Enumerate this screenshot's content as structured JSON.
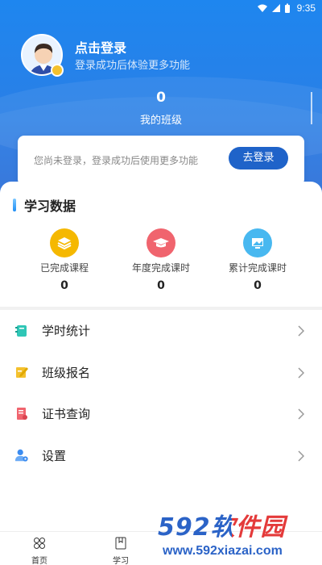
{
  "status_bar": {
    "time": "9:35"
  },
  "header": {
    "login_title": "点击登录",
    "login_subtitle": "登录成功后体验更多功能",
    "class_count": "0",
    "class_label": "我的班级"
  },
  "notice": {
    "text": "您尚未登录，登录成功后使用更多功能",
    "button": "去登录"
  },
  "learning_data": {
    "title": "学习数据",
    "stats": [
      {
        "label": "已完成课程",
        "value": "0",
        "icon": "layers-icon",
        "color": "#f5b800"
      },
      {
        "label": "年度完成课时",
        "value": "0",
        "icon": "graduation-cap-icon",
        "color": "#f0646e"
      },
      {
        "label": "累计完成课时",
        "value": "0",
        "icon": "monitor-icon",
        "color": "#48b8f0"
      }
    ]
  },
  "menu": [
    {
      "label": "学时统计",
      "icon": "notebook-icon",
      "color": "#2fc6b6"
    },
    {
      "label": "班级报名",
      "icon": "edit-icon",
      "color": "#f4c12e"
    },
    {
      "label": "证书查询",
      "icon": "certificate-icon",
      "color": "#f0646e"
    },
    {
      "label": "设置",
      "icon": "user-settings-icon",
      "color": "#3b8cf0"
    }
  ],
  "bottom_nav": [
    {
      "label": "首页",
      "icon": "home-icon"
    },
    {
      "label": "学习",
      "icon": "book-icon"
    }
  ],
  "watermark": {
    "main": "592软件园",
    "sub": "www.592xiazai.com"
  },
  "colors": {
    "primary": "#1e86ef",
    "button": "#1f63c9"
  }
}
